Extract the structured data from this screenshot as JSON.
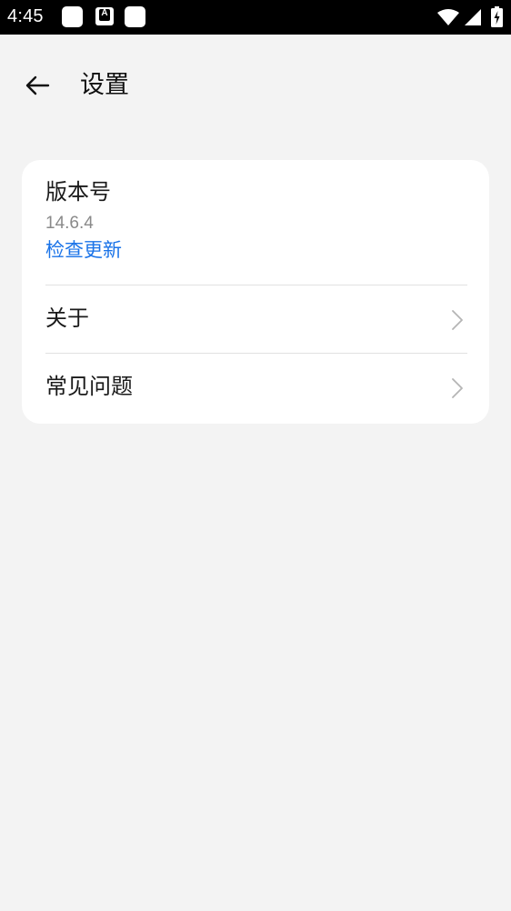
{
  "status_bar": {
    "time": "4:45",
    "icons": [
      "notification-icon",
      "a-icon",
      "notification-icon",
      "wifi-icon",
      "signal-icon",
      "battery-charging-icon"
    ]
  },
  "header": {
    "back_icon": "arrow-left-icon",
    "title": "设置"
  },
  "settings": {
    "version": {
      "label": "版本号",
      "value": "14.6.4",
      "check_update": "检查更新"
    },
    "items": [
      {
        "label": "关于",
        "icon": "chevron-right-icon"
      },
      {
        "label": "常见问题",
        "icon": "chevron-right-icon"
      }
    ]
  },
  "colors": {
    "background": "#f3f3f3",
    "card": "#ffffff",
    "accent": "#1a73e8",
    "status_bar": "#000000"
  }
}
